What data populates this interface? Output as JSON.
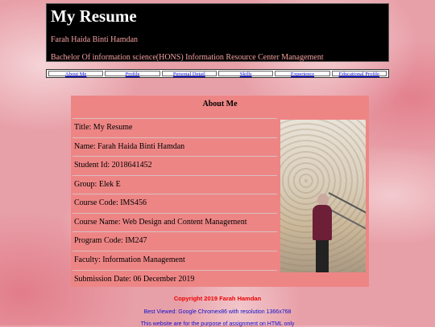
{
  "header": {
    "title": "My Resume",
    "name": "Farah Haida Binti Hamdan",
    "degree": "Bachelor Of information science(HONS) Information Resource Center Management"
  },
  "nav": {
    "items": [
      "About Me",
      "Profile",
      "Personal Detail",
      "Skills",
      "Experience",
      "Educational Profile"
    ]
  },
  "about": {
    "heading": "About Me",
    "rows": [
      "Title: My Resume",
      "Name: Farah Haida Binti Hamdan",
      "Student Id: 2018641452",
      "Group: Elek E",
      "Course Code: IMS456",
      "Course Name: Web Design and Content Management",
      "Program Code: IM247",
      "Faculty: Information Management",
      "Submission Date: 06 December 2019"
    ]
  },
  "footer": {
    "copyright": "Copyright 2019 Farah Hamdan",
    "best_viewed": "Best Viewed: Google Chromex86 with resolution 1366x768",
    "purpose": "This website are for the purpose of assignment on HTML only"
  }
}
